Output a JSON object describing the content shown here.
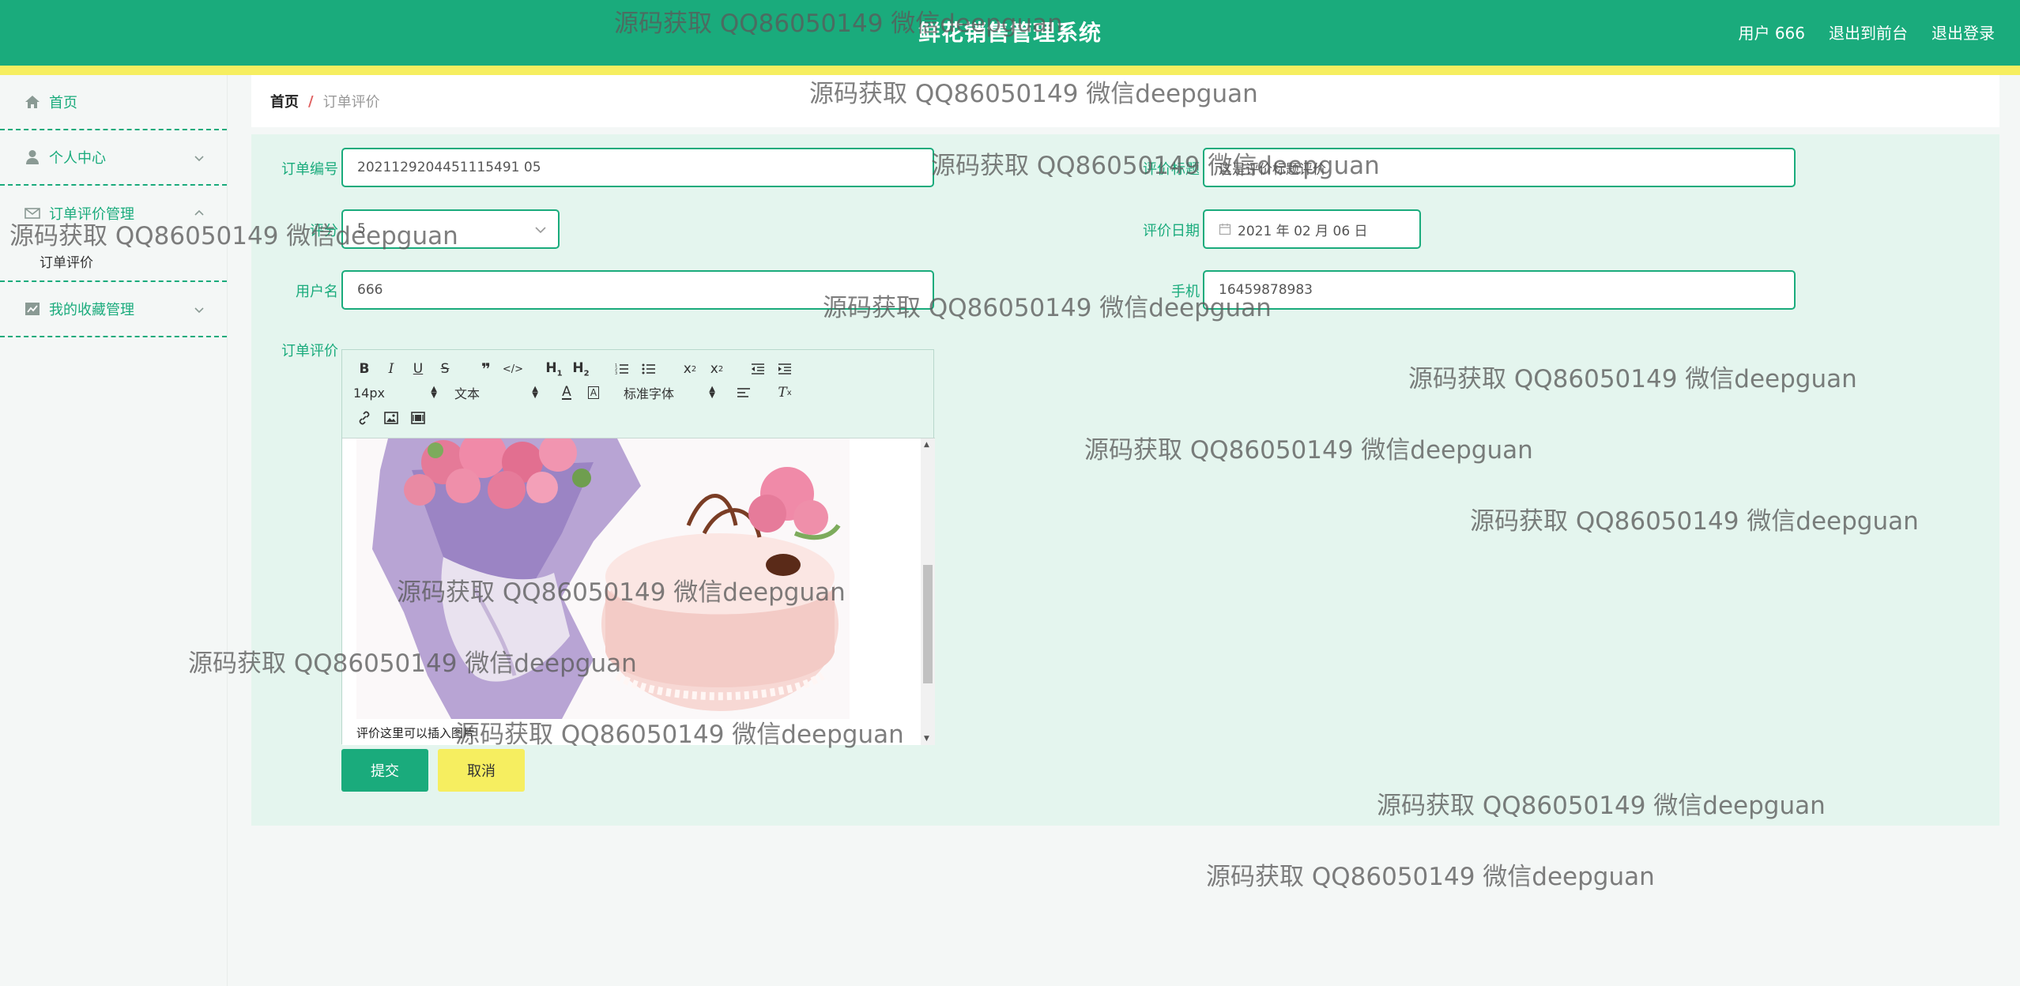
{
  "header": {
    "title": "鲜花销售管理系统",
    "user_label": "用户 666",
    "to_front_label": "退出到前台",
    "logout_label": "退出登录"
  },
  "sidebar": {
    "items": [
      {
        "label": "首页",
        "icon": "home-icon"
      },
      {
        "label": "个人中心",
        "icon": "user-icon"
      },
      {
        "label": "订单评价管理",
        "icon": "mail-icon",
        "expanded": true,
        "children": [
          {
            "label": "订单评价"
          }
        ]
      },
      {
        "label": "我的收藏管理",
        "icon": "chart-icon"
      }
    ]
  },
  "breadcrumb": {
    "home": "首页",
    "separator": "/",
    "current": "订单评价"
  },
  "form": {
    "order_no_label": "订单编号",
    "order_no_value": "2021129204451115491 05",
    "title_label": "评价标题",
    "title_value": "这是评价标题评价",
    "rating_label": "评分",
    "rating_value": "5",
    "date_label": "评价日期",
    "date_value": "2021 年 02 月 06 日",
    "username_label": "用户名",
    "username_value": "666",
    "phone_label": "手机",
    "phone_value": "16459878983",
    "review_label": "订单评价",
    "editor": {
      "font_size": "14px",
      "text_type": "文本",
      "font_family": "标准字体",
      "content_text": "评价这里可以插入图片"
    },
    "submit_label": "提交",
    "cancel_label": "取消"
  },
  "watermark": "源码获取 QQ86050149 微信deepguan",
  "colors": {
    "primary": "#1aab7c",
    "accent_yellow": "#f6ee60",
    "panel_bg": "#e4f5ee"
  }
}
